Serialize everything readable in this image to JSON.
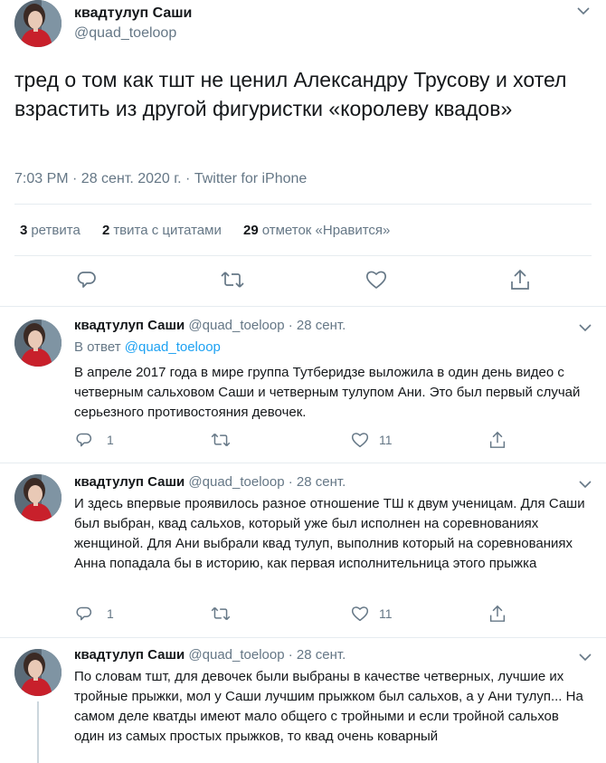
{
  "main": {
    "author_name": "квадтулуп Саши",
    "author_handle": "@quad_toeloop",
    "text": "тред о том как тшт не ценил Александру Трусову и хотел взрастить из другой фигуристки «королеву квадов»",
    "meta": "7:03 PM · 28 сент. 2020 г. · Twitter for iPhone",
    "stats": {
      "retweets_count": "3",
      "retweets_label": "ретвита",
      "quotes_count": "2",
      "quotes_label": "твита с цитатами",
      "likes_count": "29",
      "likes_label": "отметок «Нравится»"
    },
    "menu_icon": "chevron-down-icon",
    "action_icons": [
      "reply-icon",
      "retweet-icon",
      "like-icon",
      "share-icon"
    ]
  },
  "replies": [
    {
      "author_name": "квадтулуп Саши",
      "author_handle": "@quad_toeloop",
      "sep": "·",
      "date": "28 сент.",
      "replying_prefix": "В ответ",
      "replying_to": "@quad_toeloop",
      "text": "В апреле 2017 года в мире группа Тутберидзе выложила в один день видео с четверным сальховом Саши и четверным тулупом Ани. Это был первый случай серьезного противостояния девочек.",
      "reply_count": "1",
      "retweet_count": "",
      "like_count": "11"
    },
    {
      "author_name": "квадтулуп Саши",
      "author_handle": "@quad_toeloop",
      "sep": "·",
      "date": "28 сент.",
      "text": "И здесь впервые проявилось разное отношение ТШ к двум ученицам. Для Саши был выбран, квад сальхов, который уже был исполнен на соревнованиях женщиной. Для Ани выбрали квад тулуп, выполнив который на соревнованиях Анна попадала бы в историю, как первая исполнительница этого прыжка",
      "reply_count": "1",
      "retweet_count": "",
      "like_count": "11"
    },
    {
      "author_name": "квадтулуп Саши",
      "author_handle": "@quad_toeloop",
      "sep": "·",
      "date": "28 сент.",
      "text": "По словам тшт, для девочек были выбраны в качестве четверных, лучшие их тройные прыжки, мол у Саши лучшим прыжком был сальхов, а у Ани тулуп... На самом деле кватды имеют мало общего с тройными и если тройной сальхов один из самых простых прыжков, то квад очень коварный"
    }
  ],
  "colors": {
    "text": "#14171a",
    "secondary": "#657786",
    "link": "#1da1f2",
    "border": "#e6ecf0"
  }
}
